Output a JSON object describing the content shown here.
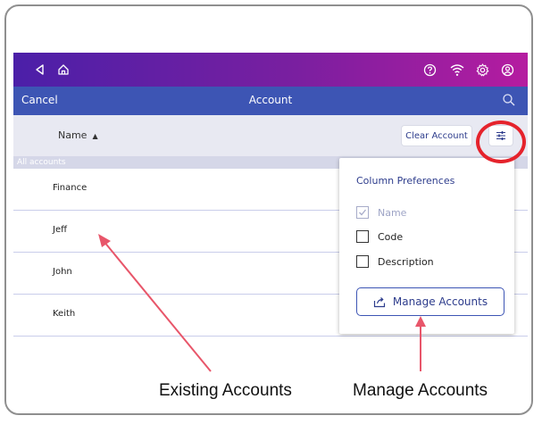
{
  "statusbar": {
    "icons": [
      "back-icon",
      "home-icon",
      "help-icon",
      "wifi-icon",
      "settings-icon",
      "account-icon"
    ]
  },
  "navbar": {
    "cancel_label": "Cancel",
    "title": "Account"
  },
  "table": {
    "column_header": "Name",
    "sort_indicator": "▲",
    "clear_account_label": "Clear Account",
    "section_label": "All accounts",
    "rows": [
      "Finance",
      "Jeff",
      "John",
      "Keith"
    ]
  },
  "column_preferences": {
    "title": "Column Preferences",
    "options": [
      {
        "label": "Name",
        "checked": true,
        "disabled": true
      },
      {
        "label": "Code",
        "checked": false,
        "disabled": false
      },
      {
        "label": "Description",
        "checked": false,
        "disabled": false
      }
    ],
    "manage_button_label": "Manage Accounts"
  },
  "annotations": {
    "existing_accounts": "Existing Accounts",
    "manage_accounts": "Manage Accounts"
  },
  "colors": {
    "status_gradient_start": "#4b1fa8",
    "status_gradient_end": "#b51ca0",
    "navbar": "#3d55b4",
    "highlight_circle": "#e5232c",
    "arrow": "#e8566a"
  }
}
